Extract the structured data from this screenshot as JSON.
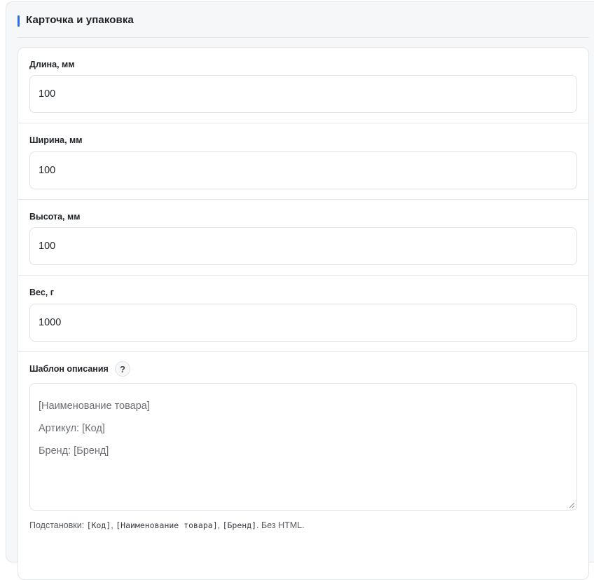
{
  "section": {
    "title": "Карточка и упаковка"
  },
  "fields": {
    "length": {
      "label": "Длина, мм",
      "value": "100"
    },
    "width": {
      "label": "Ширина, мм",
      "value": "100"
    },
    "height": {
      "label": "Высота, мм",
      "value": "100"
    },
    "weight": {
      "label": "Вес, г",
      "value": "1000"
    }
  },
  "template": {
    "label": "Шаблон описания",
    "help_icon": "?",
    "lines": [
      "[Наименование товара]",
      "Артикул: [Код]",
      "Бренд: [Бренд]"
    ],
    "hint": {
      "prefix": "Подстановки: ",
      "tokens": [
        "[Код]",
        "[Наименование товара]",
        "[Бренд]"
      ],
      "sep": ", ",
      "suffix": ". Без HTML."
    }
  },
  "colors": {
    "accent": "#2f6fe4",
    "panel_bg": "#f6f7f9",
    "border": "#e3e6ea"
  }
}
